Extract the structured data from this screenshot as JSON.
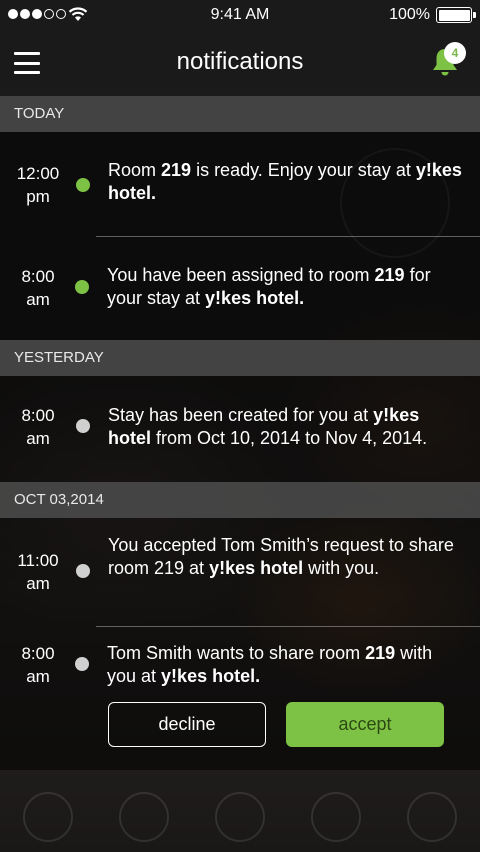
{
  "status_bar": {
    "time": "9:41 AM",
    "battery": "100%",
    "signal_bars": 3,
    "signal_total": 5
  },
  "header": {
    "title": "notifications",
    "notification_count": "4",
    "menu_icon": "hamburger-icon",
    "bell_icon": "bell-icon"
  },
  "colors": {
    "accent": "#7dc245",
    "unread_dot": "#7dc245",
    "read_dot": "#d0d0d0",
    "section_header_bg": "#464646"
  },
  "sections": [
    {
      "label": "TODAY",
      "items": [
        {
          "time": "12:00",
          "period": "pm",
          "status": "unread",
          "parts": [
            {
              "t": "Room "
            },
            {
              "t": "219",
              "b": true
            },
            {
              "t": " is ready. Enjoy your stay at "
            },
            {
              "t": "y!kes hotel.",
              "b": true
            }
          ]
        },
        {
          "time": "8:00",
          "period": "am",
          "status": "unread",
          "parts": [
            {
              "t": "You have been assigned to room "
            },
            {
              "t": "219",
              "b": true
            },
            {
              "t": " for your stay at "
            },
            {
              "t": "y!kes hotel.",
              "b": true
            }
          ]
        }
      ]
    },
    {
      "label": "YESTERDAY",
      "items": [
        {
          "time": "8:00",
          "period": "am",
          "status": "read",
          "parts": [
            {
              "t": "Stay has been created for you at "
            },
            {
              "t": "y!kes hotel",
              "b": true
            },
            {
              "t": " from Oct 10, 2014 to Nov 4, 2014."
            }
          ]
        }
      ]
    },
    {
      "label": "OCT 03,2014",
      "items": [
        {
          "time": "11:00",
          "period": "am",
          "status": "read",
          "parts": [
            {
              "t": "You accepted Tom Smith’s request to share room 219 at "
            },
            {
              "t": "y!kes hotel",
              "b": true
            },
            {
              "t": " with you."
            }
          ]
        },
        {
          "time": "8:00",
          "period": "am",
          "status": "read",
          "parts": [
            {
              "t": "Tom Smith wants to share room "
            },
            {
              "t": "219",
              "b": true
            },
            {
              "t": " with you at "
            },
            {
              "t": "y!kes hotel.",
              "b": true
            }
          ],
          "actions": {
            "decline": "decline",
            "accept": "accept"
          }
        }
      ]
    }
  ]
}
